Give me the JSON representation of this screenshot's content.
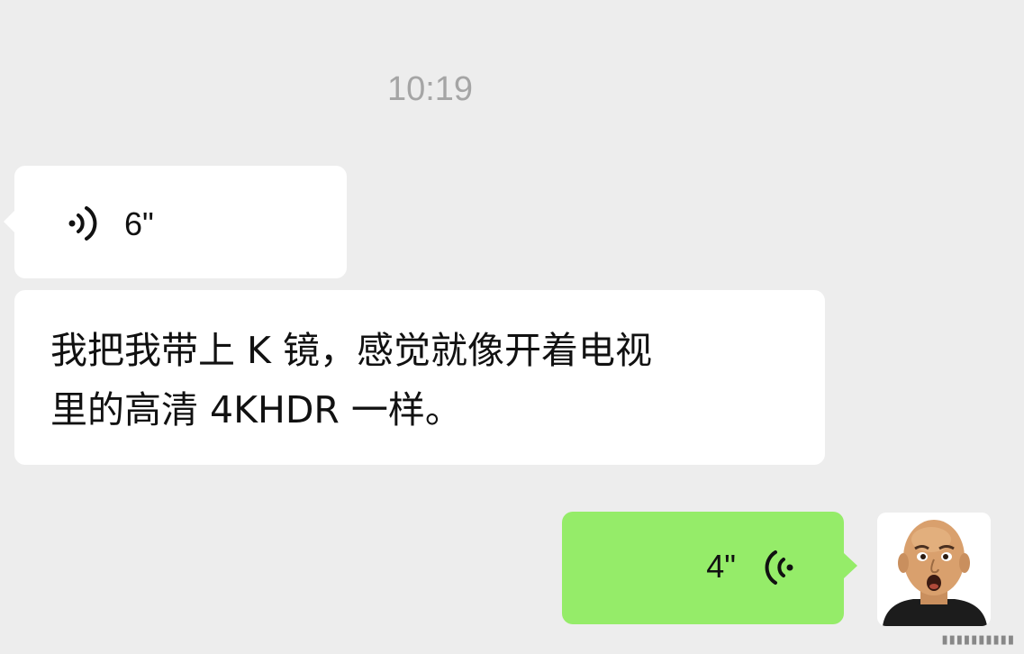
{
  "chat": {
    "timestamp": "10:19",
    "messages": [
      {
        "sender": "other",
        "type": "voice",
        "duration": "6\""
      },
      {
        "sender": "other",
        "type": "text",
        "lines": [
          "我把我带上 K 镜，感觉就像开着电视",
          "里的高清 4KHDR 一样。"
        ]
      },
      {
        "sender": "me",
        "type": "voice",
        "duration": "4\""
      }
    ]
  },
  "icons": {
    "incoming_voice": "voice-wave-icon",
    "outgoing_voice": "voice-wave-icon",
    "avatar": "bald-man-avatar"
  },
  "colors": {
    "background": "#ededed",
    "incoming_bubble": "#ffffff",
    "outgoing_bubble": "#95ec69",
    "timestamp": "#a5a5a5"
  }
}
